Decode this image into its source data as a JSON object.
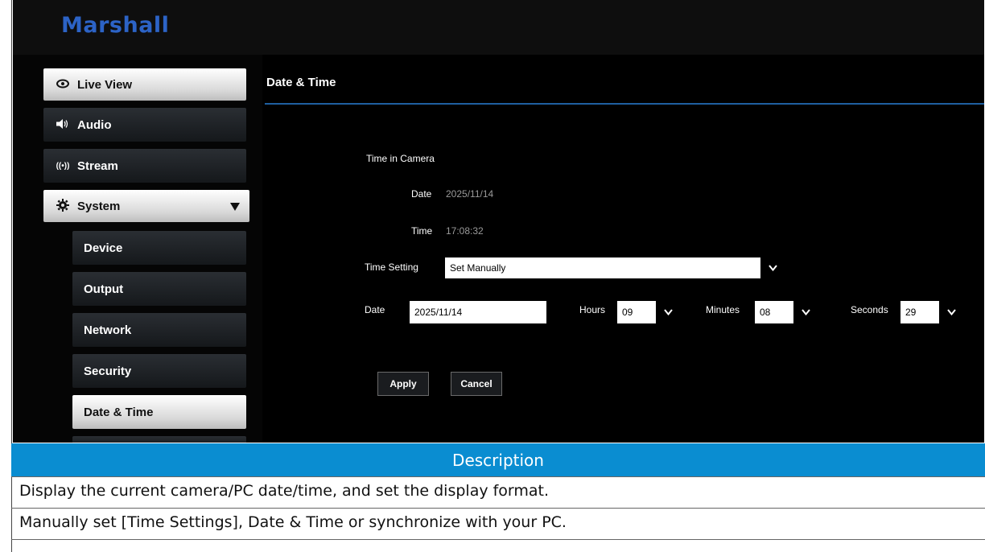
{
  "brand": {
    "logo": "Marshall"
  },
  "sidebar": {
    "items": [
      {
        "label": "Live View",
        "icon": "eye-icon"
      },
      {
        "label": "Audio",
        "icon": "speaker-icon"
      },
      {
        "label": "Stream",
        "icon": "broadcast-icon"
      },
      {
        "label": "System",
        "icon": "gear-icon",
        "expand_icon": "caret-down-icon"
      }
    ],
    "sub_items": [
      {
        "label": "Device"
      },
      {
        "label": "Output"
      },
      {
        "label": "Network"
      },
      {
        "label": "Security"
      },
      {
        "label": "Date & Time",
        "selected": true
      }
    ]
  },
  "content": {
    "title": "Date & Time",
    "time_in_camera_label": "Time in Camera",
    "date_label": "Date",
    "date_value": "2025/11/14",
    "time_label": "Time",
    "time_value": "17:08:32",
    "time_setting_label": "Time Setting",
    "time_setting_value": "Set Manually",
    "set_date_label": "Date",
    "set_date_value": "2025/11/14",
    "hours_label": "Hours",
    "hours_value": "09",
    "minutes_label": "Minutes",
    "minutes_value": "08",
    "seconds_label": "Seconds",
    "seconds_value": "29",
    "apply_label": "Apply",
    "cancel_label": "Cancel"
  },
  "description": {
    "heading": "Description",
    "lines": [
      "Display the current camera/PC date/time, and set the display format.",
      "Manually set [Time Settings], Date & Time or synchronize with your PC."
    ]
  },
  "colors": {
    "accent": "#0a8dd1",
    "brand": "#2c63c6",
    "divider": "#1e5fa0"
  }
}
